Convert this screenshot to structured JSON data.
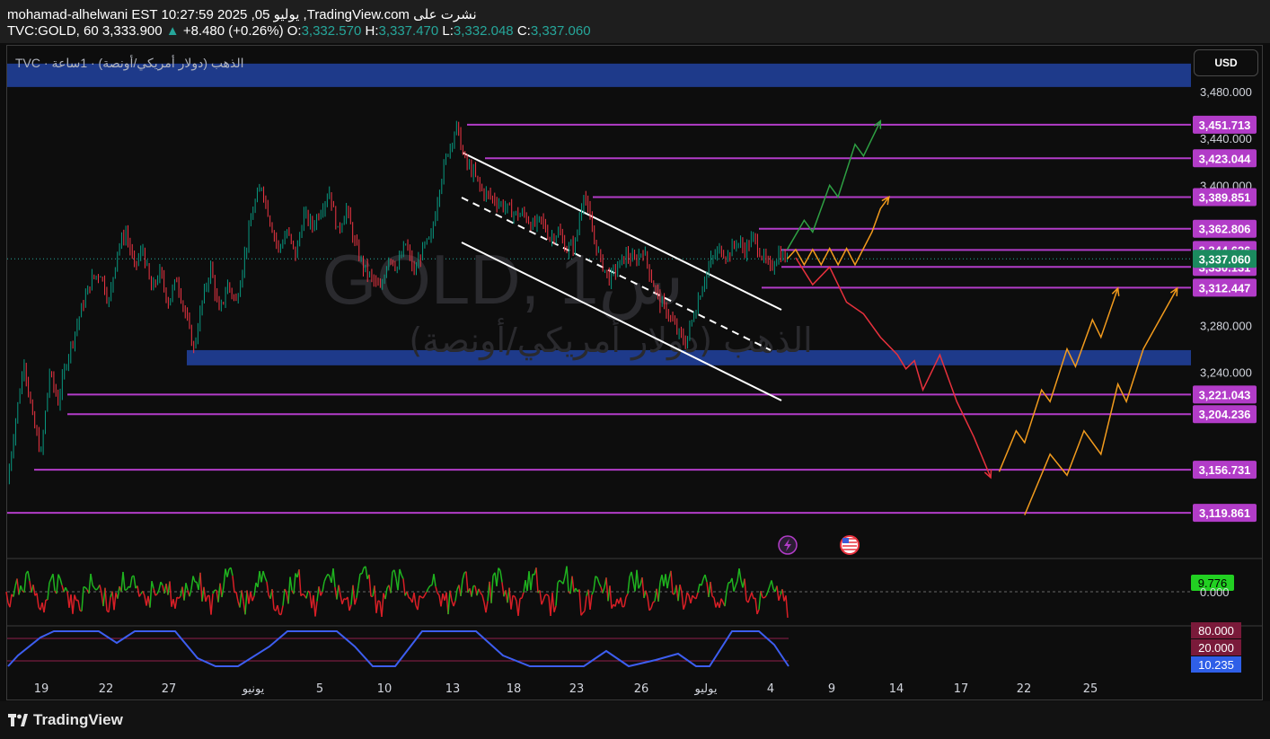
{
  "header": {
    "line1": "mohamad-alhelwani EST 10:27:59 2025 ,05 يوليو ,TradingView.com نشرت على",
    "symbol": "TVC:GOLD, 60",
    "last": "3,333.900",
    "change_arrow": "▲",
    "change": "+8.480 (+0.26%)",
    "o_label": "O:",
    "o": "3,332.570",
    "h_label": "H:",
    "h": "3,337.470",
    "l_label": "L:",
    "l": "3,332.048",
    "c_label": "C:",
    "c": "3,337.060"
  },
  "legend": {
    "text": "TVC · الذهب (دولار أمريكي/أونصة) · 1ساعة",
    "watermark_symbol": "GOLD, 1س",
    "watermark_name": "الذهب (دولار أمريكي/أونصة)"
  },
  "currency_button": "USD",
  "footer": {
    "brand": "TradingView",
    "logo_icon": "tradingview-logo-icon"
  },
  "events": {
    "lightning_icon": "lightning-icon",
    "flag_icon": "us-flag-icon"
  },
  "colors": {
    "background": "#0d0d0d",
    "up_candle": "#089981",
    "down_candle": "#f23645",
    "level_line": "#b23cc8",
    "zone": "#1e3a8a",
    "current_price_tag": "#1b8a5f",
    "green_path": "#2ea043",
    "orange_path": "#f29b1d",
    "red_path": "#e8313d",
    "oscillator_line": "#3d5ef0",
    "channel": "#ffffff"
  },
  "chart_data": {
    "type": "candlestick",
    "symbol": "TVC:GOLD",
    "interval": "60",
    "ylim": [
      3100,
      3520
    ],
    "y_ticks": [
      "3,480.000",
      "3,440.000",
      "3,400.000",
      "3,280.000",
      "3,240.000"
    ],
    "x_ticks": [
      "19",
      "22",
      "27",
      "يونيو",
      "5",
      "10",
      "13",
      "18",
      "23",
      "26",
      "يوليو",
      "4",
      "9",
      "14",
      "17",
      "22",
      "25"
    ],
    "price_path": [
      [
        0,
        3145
      ],
      [
        2,
        3200
      ],
      [
        4,
        3250
      ],
      [
        6,
        3200
      ],
      [
        8,
        3170
      ],
      [
        10,
        3240
      ],
      [
        12,
        3215
      ],
      [
        14,
        3250
      ],
      [
        16,
        3275
      ],
      [
        18,
        3300
      ],
      [
        20,
        3320
      ],
      [
        22,
        3325
      ],
      [
        24,
        3300
      ],
      [
        26,
        3345
      ],
      [
        28,
        3360
      ],
      [
        30,
        3330
      ],
      [
        32,
        3345
      ],
      [
        34,
        3310
      ],
      [
        36,
        3325
      ],
      [
        38,
        3300
      ],
      [
        40,
        3320
      ],
      [
        42,
        3290
      ],
      [
        44,
        3260
      ],
      [
        46,
        3300
      ],
      [
        48,
        3330
      ],
      [
        50,
        3290
      ],
      [
        52,
        3315
      ],
      [
        54,
        3300
      ],
      [
        56,
        3340
      ],
      [
        58,
        3380
      ],
      [
        60,
        3400
      ],
      [
        62,
        3370
      ],
      [
        64,
        3345
      ],
      [
        66,
        3360
      ],
      [
        68,
        3340
      ],
      [
        70,
        3375
      ],
      [
        72,
        3365
      ],
      [
        74,
        3380
      ],
      [
        76,
        3395
      ],
      [
        78,
        3360
      ],
      [
        80,
        3380
      ],
      [
        82,
        3350
      ],
      [
        84,
        3330
      ],
      [
        86,
        3320
      ],
      [
        88,
        3310
      ],
      [
        90,
        3340
      ],
      [
        92,
        3330
      ],
      [
        94,
        3350
      ],
      [
        96,
        3325
      ],
      [
        98,
        3345
      ],
      [
        100,
        3355
      ],
      [
        102,
        3400
      ],
      [
        104,
        3430
      ],
      [
        106,
        3450
      ],
      [
        108,
        3420
      ],
      [
        110,
        3410
      ],
      [
        112,
        3395
      ],
      [
        114,
        3390
      ],
      [
        116,
        3385
      ],
      [
        118,
        3380
      ],
      [
        120,
        3375
      ],
      [
        122,
        3375
      ],
      [
        124,
        3365
      ],
      [
        126,
        3370
      ],
      [
        128,
        3355
      ],
      [
        130,
        3360
      ],
      [
        132,
        3345
      ],
      [
        134,
        3350
      ],
      [
        136,
        3395
      ],
      [
        138,
        3360
      ],
      [
        140,
        3335
      ],
      [
        142,
        3320
      ],
      [
        144,
        3330
      ],
      [
        146,
        3340
      ],
      [
        148,
        3335
      ],
      [
        150,
        3345
      ],
      [
        152,
        3320
      ],
      [
        154,
        3300
      ],
      [
        156,
        3290
      ],
      [
        158,
        3275
      ],
      [
        160,
        3265
      ],
      [
        162,
        3290
      ],
      [
        164,
        3315
      ],
      [
        166,
        3335
      ],
      [
        168,
        3345
      ],
      [
        170,
        3340
      ],
      [
        172,
        3352
      ],
      [
        174,
        3345
      ],
      [
        176,
        3355
      ],
      [
        178,
        3340
      ],
      [
        180,
        3328
      ],
      [
        182,
        3342
      ],
      [
        184,
        3337
      ]
    ],
    "levels": [
      {
        "label": "3,451.713",
        "value": 3451.713
      },
      {
        "label": "3,423.044",
        "value": 3423.044
      },
      {
        "label": "3,389.851",
        "value": 3389.851
      },
      {
        "label": "3,362.806",
        "value": 3362.806
      },
      {
        "label": "3,344.626",
        "value": 3344.626
      },
      {
        "label": "3,330.131",
        "value": 3330.131
      },
      {
        "label": "3,312.447",
        "value": 3312.447
      },
      {
        "label": "3,221.043",
        "value": 3221.043
      },
      {
        "label": "3,204.236",
        "value": 3204.236
      },
      {
        "label": "3,156.731",
        "value": 3156.731
      },
      {
        "label": "3,119.861",
        "value": 3119.861
      }
    ],
    "current_price": {
      "label": "3,337.060",
      "value": 3337.06
    },
    "zones": [
      {
        "from": 3484,
        "to": 3504
      },
      {
        "from": 3246,
        "to": 3259
      }
    ],
    "projections": [
      {
        "color": "green",
        "points": [
          [
            184,
            3345
          ],
          [
            188,
            3370
          ],
          [
            190,
            3360
          ],
          [
            194,
            3400
          ],
          [
            196,
            3390
          ],
          [
            200,
            3435
          ],
          [
            202,
            3425
          ],
          [
            206,
            3455
          ]
        ]
      },
      {
        "color": "orange",
        "points": [
          [
            184,
            3337
          ],
          [
            186,
            3345
          ],
          [
            188,
            3332
          ],
          [
            190,
            3345
          ],
          [
            192,
            3332
          ],
          [
            194,
            3346
          ],
          [
            196,
            3332
          ],
          [
            198,
            3346
          ],
          [
            200,
            3332
          ],
          [
            202,
            3346
          ],
          [
            204,
            3360
          ],
          [
            206,
            3380
          ],
          [
            208,
            3390
          ]
        ]
      },
      {
        "color": "red",
        "points": [
          [
            186,
            3338
          ],
          [
            190,
            3315
          ],
          [
            194,
            3330
          ],
          [
            198,
            3300
          ],
          [
            202,
            3290
          ],
          [
            206,
            3270
          ],
          [
            210,
            3255
          ],
          [
            212,
            3243
          ],
          [
            214,
            3250
          ],
          [
            216,
            3225
          ],
          [
            220,
            3255
          ],
          [
            224,
            3215
          ],
          [
            228,
            3185
          ],
          [
            232,
            3150
          ]
        ]
      },
      {
        "color": "orange",
        "points": [
          [
            234,
            3155
          ],
          [
            238,
            3190
          ],
          [
            240,
            3180
          ],
          [
            244,
            3225
          ],
          [
            246,
            3215
          ],
          [
            250,
            3260
          ],
          [
            252,
            3245
          ],
          [
            256,
            3285
          ],
          [
            258,
            3270
          ],
          [
            262,
            3312
          ]
        ]
      },
      {
        "color": "orange",
        "points": [
          [
            240,
            3118
          ],
          [
            246,
            3170
          ],
          [
            250,
            3152
          ],
          [
            254,
            3190
          ],
          [
            258,
            3170
          ],
          [
            262,
            3230
          ],
          [
            264,
            3215
          ],
          [
            268,
            3260
          ],
          [
            276,
            3312
          ]
        ]
      }
    ],
    "oscillator_1": {
      "label": "9.776",
      "zero_label": "0.000"
    },
    "oscillator_2": {
      "upper_label": "80.000",
      "lower_label": "20.000",
      "value_label": "10.235"
    }
  }
}
